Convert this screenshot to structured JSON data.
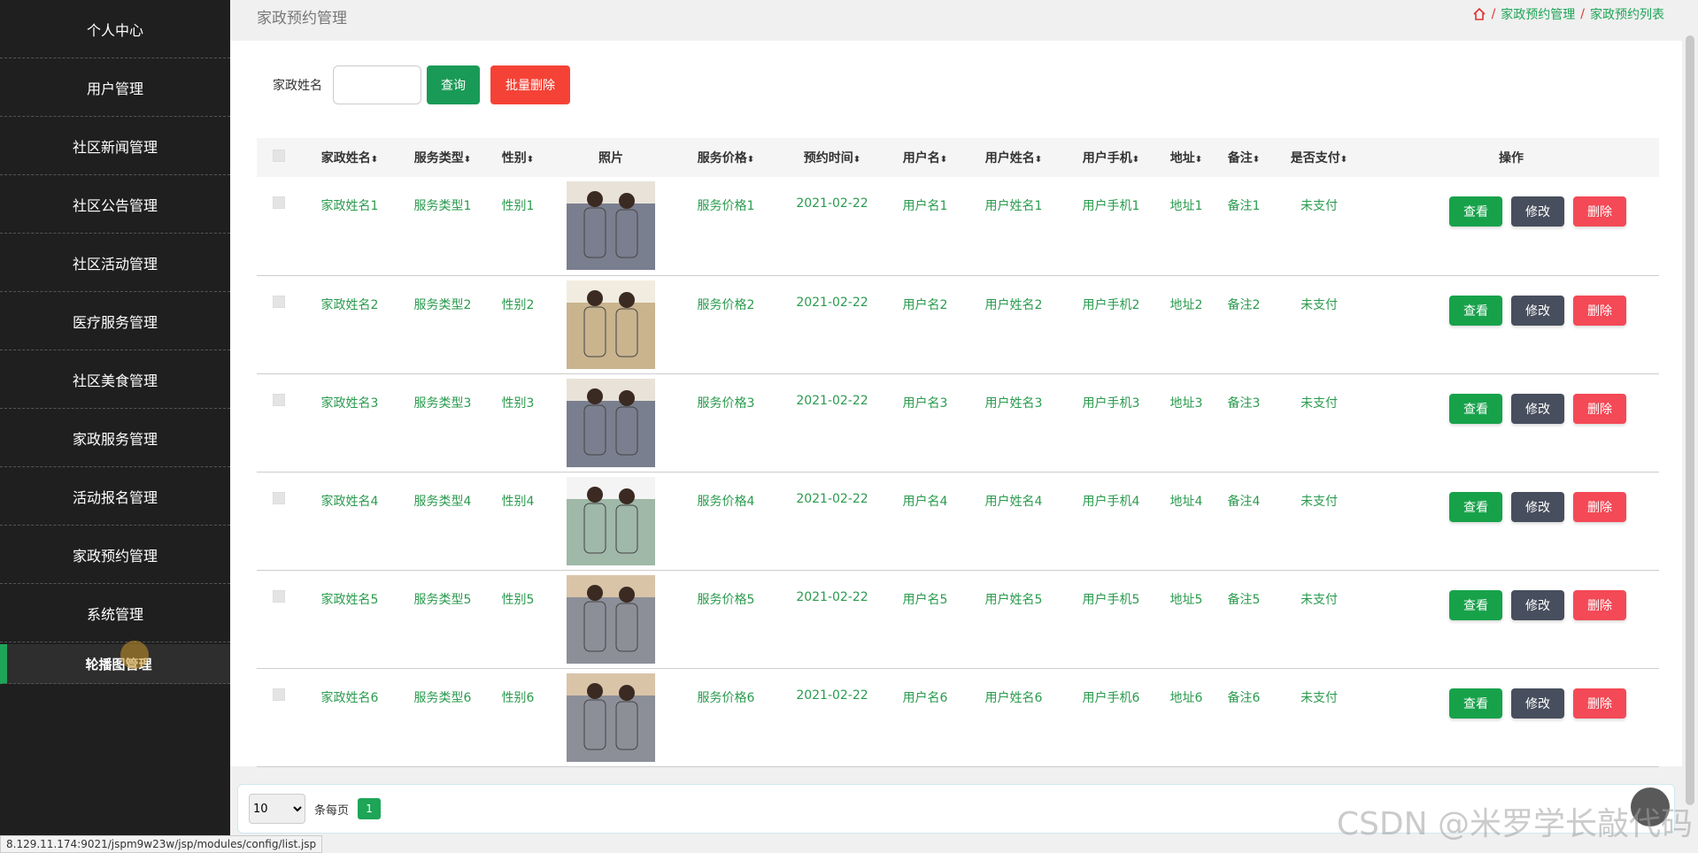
{
  "sidebar": {
    "items": [
      {
        "label": "个人中心"
      },
      {
        "label": "用户管理"
      },
      {
        "label": "社区新闻管理"
      },
      {
        "label": "社区公告管理"
      },
      {
        "label": "社区活动管理"
      },
      {
        "label": "医疗服务管理"
      },
      {
        "label": "社区美食管理"
      },
      {
        "label": "家政服务管理"
      },
      {
        "label": "活动报名管理"
      },
      {
        "label": "家政预约管理"
      },
      {
        "label": "系统管理"
      }
    ],
    "active_sub": "轮播图管理"
  },
  "header": {
    "title": "家政预约管理",
    "breadcrumb": [
      "家政预约管理",
      "家政预约列表"
    ],
    "separator": "/"
  },
  "search": {
    "label": "家政姓名",
    "value": "",
    "query_button": "查询",
    "batch_delete_button": "批量删除"
  },
  "table": {
    "columns": [
      "家政姓名",
      "服务类型",
      "性别",
      "照片",
      "服务价格",
      "预约时间",
      "用户名",
      "用户姓名",
      "用户手机",
      "地址",
      "备注",
      "是否支付",
      "操作"
    ],
    "rows": [
      {
        "name": "家政姓名1",
        "type": "服务类型1",
        "gender": "性别1",
        "photo": "staff-uniform-photo",
        "price": "服务价格1",
        "time": "2021-02-22",
        "username": "用户名1",
        "user_fullname": "用户姓名1",
        "phone": "用户手机1",
        "address": "地址1",
        "note": "备注1",
        "paid": "未支付"
      },
      {
        "name": "家政姓名2",
        "type": "服务类型2",
        "gender": "性别2",
        "photo": "staff-uniform-photo",
        "price": "服务价格2",
        "time": "2021-02-22",
        "username": "用户名2",
        "user_fullname": "用户姓名2",
        "phone": "用户手机2",
        "address": "地址2",
        "note": "备注2",
        "paid": "未支付"
      },
      {
        "name": "家政姓名3",
        "type": "服务类型3",
        "gender": "性别3",
        "photo": "staff-uniform-photo",
        "price": "服务价格3",
        "time": "2021-02-22",
        "username": "用户名3",
        "user_fullname": "用户姓名3",
        "phone": "用户手机3",
        "address": "地址3",
        "note": "备注3",
        "paid": "未支付"
      },
      {
        "name": "家政姓名4",
        "type": "服务类型4",
        "gender": "性别4",
        "photo": "staff-uniform-photo",
        "price": "服务价格4",
        "time": "2021-02-22",
        "username": "用户名4",
        "user_fullname": "用户姓名4",
        "phone": "用户手机4",
        "address": "地址4",
        "note": "备注4",
        "paid": "未支付"
      },
      {
        "name": "家政姓名5",
        "type": "服务类型5",
        "gender": "性别5",
        "photo": "staff-uniform-photo",
        "price": "服务价格5",
        "time": "2021-02-22",
        "username": "用户名5",
        "user_fullname": "用户姓名5",
        "phone": "用户手机5",
        "address": "地址5",
        "note": "备注5",
        "paid": "未支付"
      },
      {
        "name": "家政姓名6",
        "type": "服务类型6",
        "gender": "性别6",
        "photo": "staff-uniform-photo",
        "price": "服务价格6",
        "time": "2021-02-22",
        "username": "用户名6",
        "user_fullname": "用户姓名6",
        "phone": "用户手机6",
        "address": "地址6",
        "note": "备注6",
        "paid": "未支付"
      }
    ],
    "actions": {
      "view": "查看",
      "edit": "修改",
      "delete": "删除"
    }
  },
  "pager": {
    "page_size": "10",
    "per_page_label": "条每页",
    "current_page": "1"
  },
  "status_url": "8.129.11.174:9021/jspm9w23w/jsp/modules/config/list.jsp",
  "watermark": "CSDN @米罗学长敲代码",
  "colors": {
    "accent": "#1ea557",
    "danger": "#f44336",
    "dark": "#474e5d",
    "sidebar": "#1f1f1f"
  }
}
